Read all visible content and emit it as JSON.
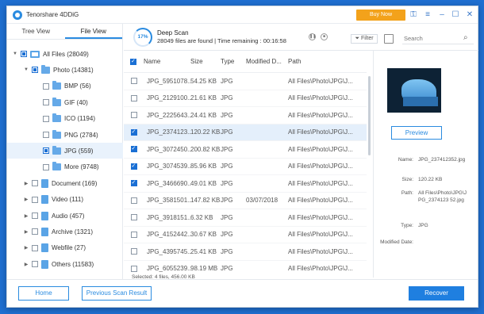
{
  "app": {
    "title": "Tenorshare 4DDiG",
    "buy_label": "Buy Now",
    "icons": [
      "key-icon",
      "menu-icon",
      "minimize-icon",
      "maximize-icon",
      "close-icon"
    ]
  },
  "tabs": [
    {
      "label": "Tree View",
      "active": false
    },
    {
      "label": "File View",
      "active": true
    }
  ],
  "tree": [
    {
      "label": "All Files (28049)",
      "level": 0,
      "expander": "▼",
      "check": "partial",
      "icon": "computer-icon"
    },
    {
      "label": "Photo (14381)",
      "level": 1,
      "expander": "▼",
      "check": "partial",
      "icon": "folder-icon"
    },
    {
      "label": "BMP (56)",
      "level": 2,
      "expander": "",
      "check": "none",
      "icon": "folder-icon"
    },
    {
      "label": "GIF (40)",
      "level": 2,
      "expander": "",
      "check": "none",
      "icon": "folder-icon"
    },
    {
      "label": "ICO (1194)",
      "level": 2,
      "expander": "",
      "check": "none",
      "icon": "folder-icon"
    },
    {
      "label": "PNG (2784)",
      "level": 2,
      "expander": "",
      "check": "none",
      "icon": "folder-icon"
    },
    {
      "label": "JPG (559)",
      "level": 2,
      "expander": "",
      "check": "partial",
      "icon": "folder-icon",
      "selected": true
    },
    {
      "label": "More (9748)",
      "level": 2,
      "expander": "",
      "check": "none",
      "icon": "folder-icon"
    },
    {
      "label": "Document (169)",
      "level": 1,
      "expander": "▶",
      "check": "none",
      "icon": "document-icon"
    },
    {
      "label": "Video (111)",
      "level": 1,
      "expander": "▶",
      "check": "none",
      "icon": "video-icon"
    },
    {
      "label": "Audio (457)",
      "level": 1,
      "expander": "▶",
      "check": "none",
      "icon": "audio-icon"
    },
    {
      "label": "Archive (1321)",
      "level": 1,
      "expander": "▶",
      "check": "none",
      "icon": "archive-icon"
    },
    {
      "label": "Webfile (27)",
      "level": 1,
      "expander": "▶",
      "check": "none",
      "icon": "webfile-icon"
    },
    {
      "label": "Others (11583)",
      "level": 1,
      "expander": "▶",
      "check": "none",
      "icon": "others-icon"
    }
  ],
  "scan": {
    "progress": "17%",
    "progress_value": 0.17,
    "title": "Deep Scan",
    "status": "28049 files are found",
    "remaining": "Time remaining : 00:16:58",
    "filter_label": "Filter",
    "search_placeholder": "Search"
  },
  "table": {
    "columns": [
      "Name",
      "Size",
      "Type",
      "Modified D...",
      "Path"
    ],
    "rows": [
      {
        "name": "JPG_5951078...",
        "size": "54.25 KB",
        "type": "JPG",
        "modified": "",
        "path": "All Files\\Photo\\JPG\\J...",
        "checked": false,
        "selected": false
      },
      {
        "name": "JPG_2129100...",
        "size": "21.61 KB",
        "type": "JPG",
        "modified": "",
        "path": "All Files\\Photo\\JPG\\J...",
        "checked": false,
        "selected": false
      },
      {
        "name": "JPG_2225643...",
        "size": "24.41 KB",
        "type": "JPG",
        "modified": "",
        "path": "All Files\\Photo\\JPG\\J...",
        "checked": false,
        "selected": false
      },
      {
        "name": "JPG_2374123...",
        "size": "120.22 KB",
        "type": "JPG",
        "modified": "",
        "path": "All Files\\Photo\\JPG\\J...",
        "checked": true,
        "selected": true
      },
      {
        "name": "JPG_3072450...",
        "size": "200.82 KB",
        "type": "JPG",
        "modified": "",
        "path": "All Files\\Photo\\JPG\\J...",
        "checked": true,
        "selected": false
      },
      {
        "name": "JPG_3074539...",
        "size": "85.96 KB",
        "type": "JPG",
        "modified": "",
        "path": "All Files\\Photo\\JPG\\J...",
        "checked": true,
        "selected": false
      },
      {
        "name": "JPG_3466690...",
        "size": "49.01 KB",
        "type": "JPG",
        "modified": "",
        "path": "All Files\\Photo\\JPG\\J...",
        "checked": true,
        "selected": false
      },
      {
        "name": "JPG_3581501...",
        "size": "147.82 KB",
        "type": "JPG",
        "modified": "03/07/2018",
        "path": "All Files\\Photo\\JPG\\J...",
        "checked": false,
        "selected": false
      },
      {
        "name": "JPG_3918151...",
        "size": "6.32 KB",
        "type": "JPG",
        "modified": "",
        "path": "All Files\\Photo\\JPG\\J...",
        "checked": false,
        "selected": false
      },
      {
        "name": "JPG_4152442...",
        "size": "30.67 KB",
        "type": "JPG",
        "modified": "",
        "path": "All Files\\Photo\\JPG\\J...",
        "checked": false,
        "selected": false
      },
      {
        "name": "JPG_4395745...",
        "size": "25.41 KB",
        "type": "JPG",
        "modified": "",
        "path": "All Files\\Photo\\JPG\\J...",
        "checked": false,
        "selected": false
      },
      {
        "name": "JPG_6055239...",
        "size": "98.19 MB",
        "type": "JPG",
        "modified": "",
        "path": "All Files\\Photo\\JPG\\J...",
        "checked": false,
        "selected": false
      }
    ],
    "status": "Selected: 4 files, 456.00 KB"
  },
  "preview": {
    "button_label": "Preview",
    "meta": [
      {
        "key": "Name:",
        "value": "JPG_237412352.jpg"
      },
      {
        "key": "Size:",
        "value": "120.22 KB"
      },
      {
        "key": "Path:",
        "value": "All Files\\Photo\\JPG\\JPG_2374123 52.jpg"
      },
      {
        "key": "Type:",
        "value": "JPG"
      },
      {
        "key": "Modified Date:",
        "value": ""
      }
    ]
  },
  "footer": {
    "home_label": "Home",
    "previous_label": "Previous Scan Result",
    "recover_label": "Recover"
  },
  "colors": {
    "accent": "#2a8be0",
    "buy": "#f3a21b",
    "selected_row": "#e4effb",
    "desktop": "#1f6fd1"
  }
}
